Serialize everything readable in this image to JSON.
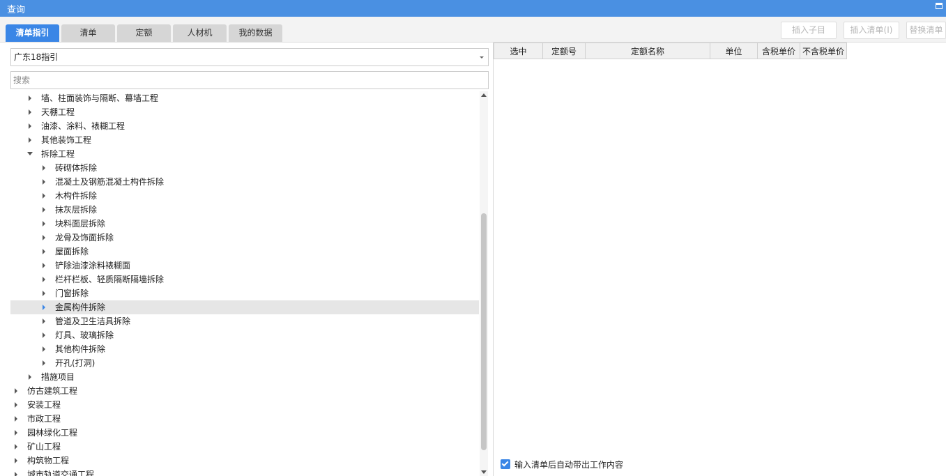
{
  "window": {
    "title": "查询",
    "maximize_icon": "maximize-icon"
  },
  "tabs": [
    {
      "label": "清单指引",
      "active": true
    },
    {
      "label": "清单",
      "active": false
    },
    {
      "label": "定额",
      "active": false
    },
    {
      "label": "人材机",
      "active": false
    },
    {
      "label": "我的数据",
      "active": false
    }
  ],
  "toolbar": {
    "insert_child_label": "插入子目",
    "insert_list_label": "插入清单(I)",
    "replace_list_label": "替换清单"
  },
  "guide_select": {
    "value": "广东18指引"
  },
  "search": {
    "placeholder": "搜索"
  },
  "tree": [
    {
      "level": 1,
      "state": "collapsed",
      "label": "墙、柱面装饰与隔断、幕墙工程"
    },
    {
      "level": 1,
      "state": "collapsed",
      "label": "天棚工程"
    },
    {
      "level": 1,
      "state": "collapsed",
      "label": "油漆、涂料、裱糊工程"
    },
    {
      "level": 1,
      "state": "collapsed",
      "label": "其他装饰工程"
    },
    {
      "level": 1,
      "state": "expanded",
      "label": "拆除工程"
    },
    {
      "level": 2,
      "state": "collapsed",
      "label": "砖砌体拆除"
    },
    {
      "level": 2,
      "state": "collapsed",
      "label": "混凝土及钢筋混凝土构件拆除"
    },
    {
      "level": 2,
      "state": "collapsed",
      "label": "木构件拆除"
    },
    {
      "level": 2,
      "state": "collapsed",
      "label": "抹灰层拆除"
    },
    {
      "level": 2,
      "state": "collapsed",
      "label": "块料面层拆除"
    },
    {
      "level": 2,
      "state": "collapsed",
      "label": "龙骨及饰面拆除"
    },
    {
      "level": 2,
      "state": "collapsed",
      "label": "屋面拆除"
    },
    {
      "level": 2,
      "state": "collapsed",
      "label": "铲除油漆涂料裱糊面"
    },
    {
      "level": 2,
      "state": "collapsed",
      "label": "栏杆栏板、轻质隔断隔墙拆除"
    },
    {
      "level": 2,
      "state": "collapsed",
      "label": "门窗拆除"
    },
    {
      "level": 2,
      "state": "collapsed",
      "label": "金属构件拆除",
      "selected": true
    },
    {
      "level": 2,
      "state": "collapsed",
      "label": "管道及卫生洁具拆除"
    },
    {
      "level": 2,
      "state": "collapsed",
      "label": "灯具、玻璃拆除"
    },
    {
      "level": 2,
      "state": "collapsed",
      "label": "其他构件拆除"
    },
    {
      "level": 2,
      "state": "collapsed",
      "label": "开孔(打洞)"
    },
    {
      "level": 1,
      "state": "collapsed",
      "label": "措施项目"
    },
    {
      "level": 0,
      "state": "collapsed",
      "label": "仿古建筑工程"
    },
    {
      "level": 0,
      "state": "collapsed",
      "label": "安装工程"
    },
    {
      "level": 0,
      "state": "collapsed",
      "label": "市政工程"
    },
    {
      "level": 0,
      "state": "collapsed",
      "label": "园林绿化工程"
    },
    {
      "level": 0,
      "state": "collapsed",
      "label": "矿山工程"
    },
    {
      "level": 0,
      "state": "collapsed",
      "label": "构筑物工程"
    },
    {
      "level": 0,
      "state": "collapsed",
      "label": "城市轨道交通工程"
    }
  ],
  "quota_grid": {
    "columns": [
      "选中",
      "定额号",
      "定额名称",
      "单位",
      "含税单价",
      "不含税单价"
    ],
    "rows": []
  },
  "auto_bring_work": {
    "checked": true,
    "label": "输入清单后自动带出工作内容"
  },
  "colors": {
    "title_bar": "#4a90e2",
    "accent": "#3a86e6",
    "selected_row": "#e6e6e6"
  }
}
